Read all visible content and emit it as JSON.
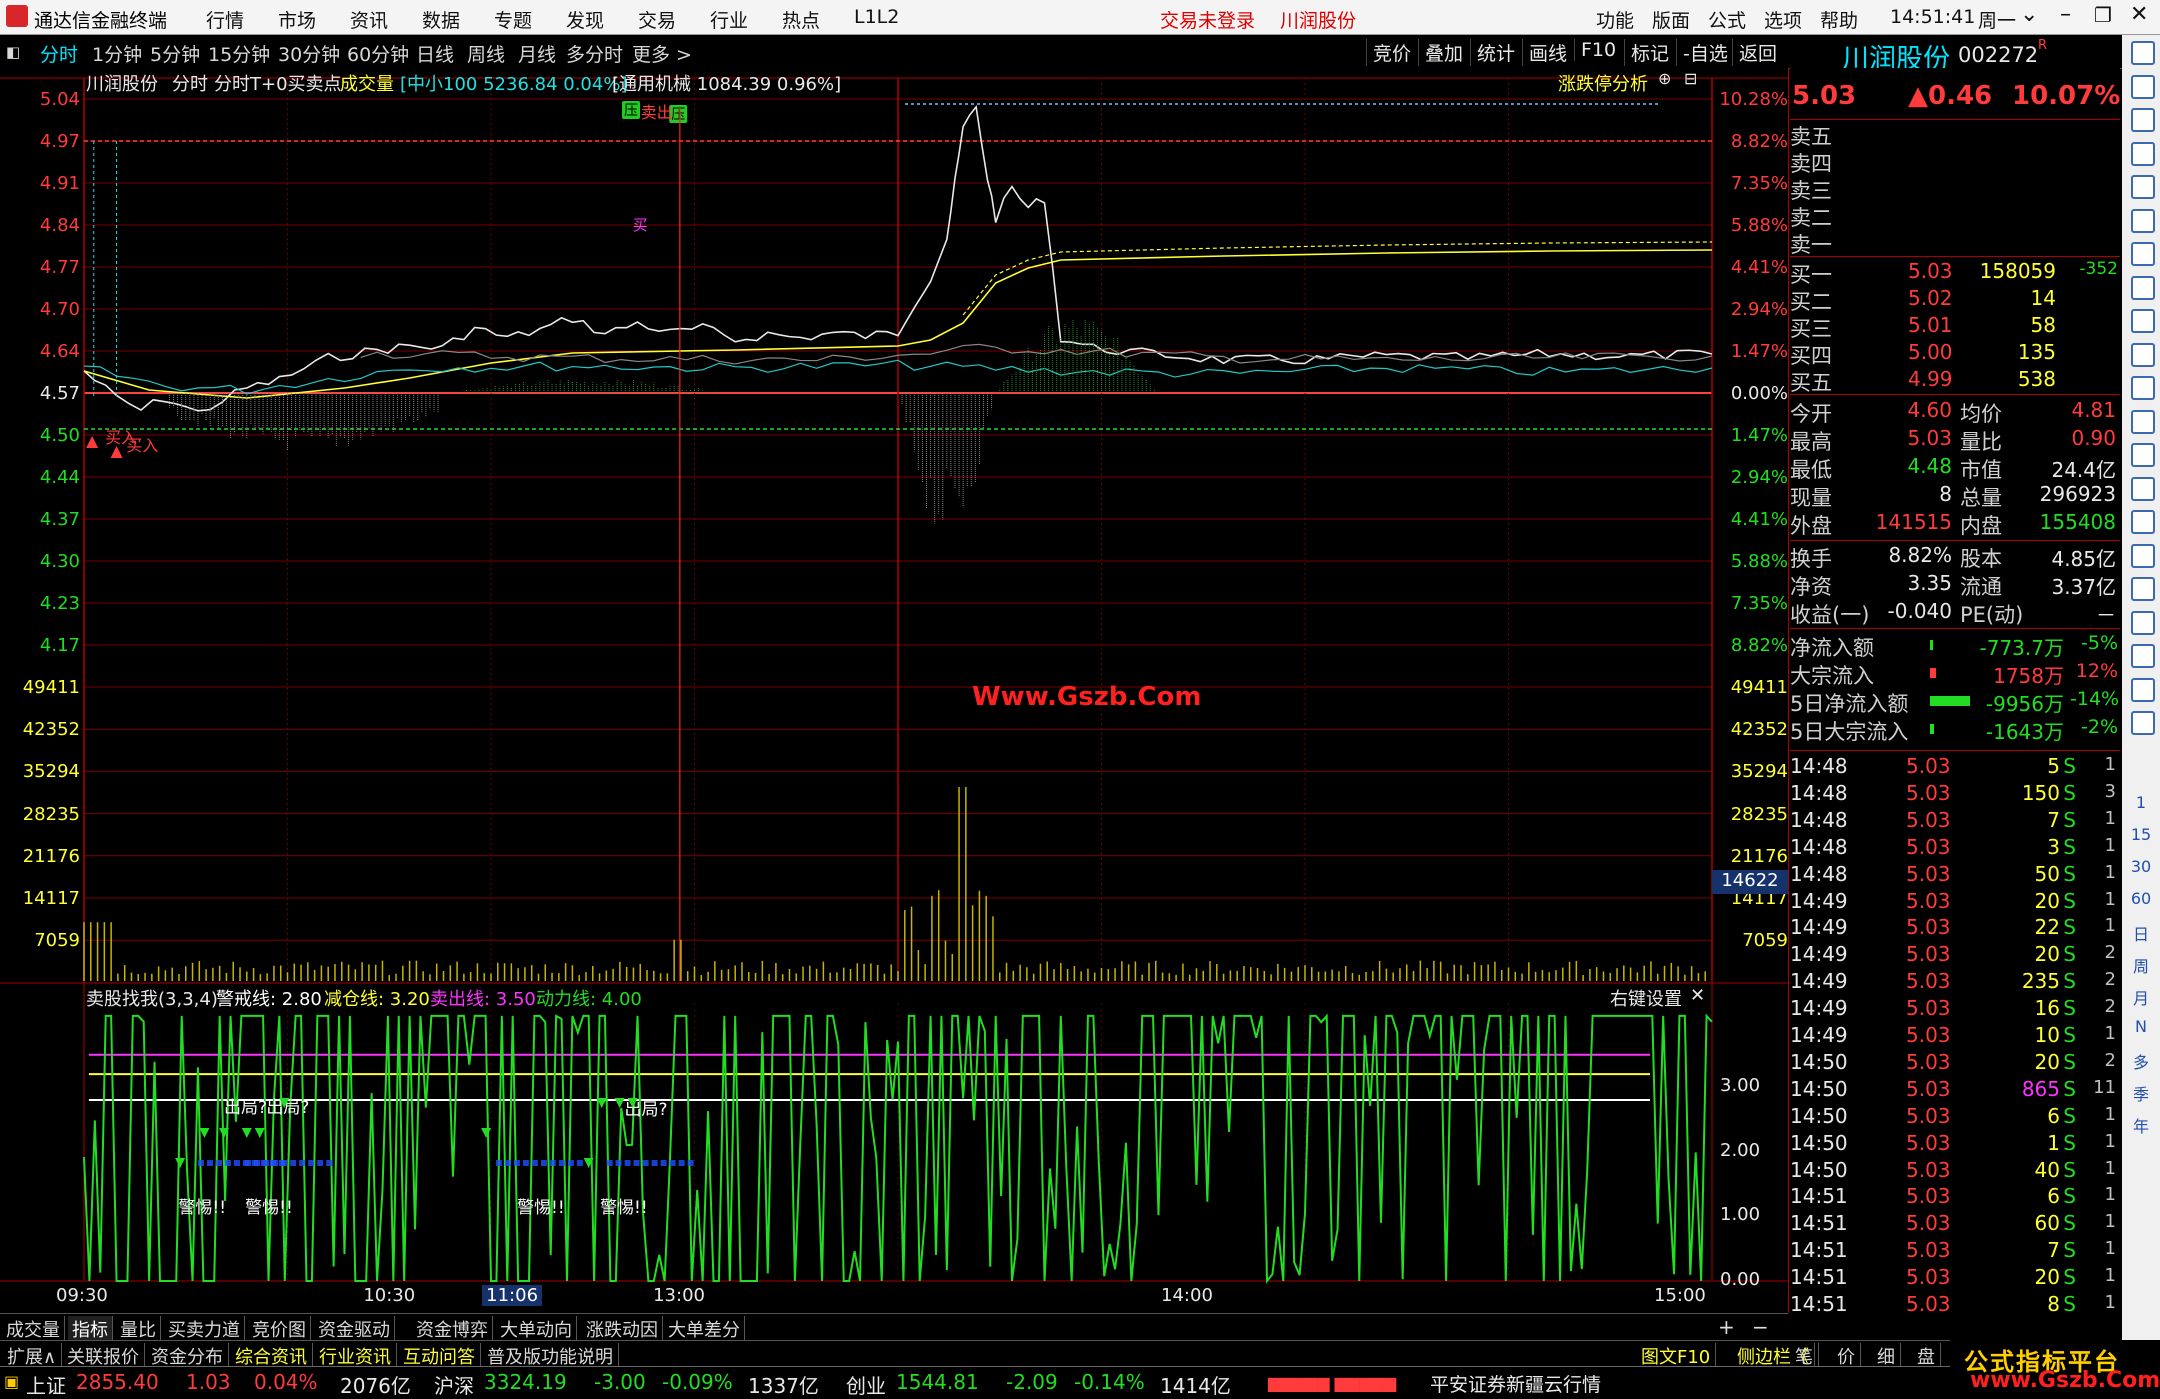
{
  "app": {
    "title": "通达信金融终端",
    "menu": [
      "行情",
      "市场",
      "资讯",
      "数据",
      "专题",
      "发现",
      "交易",
      "行业",
      "热点",
      "L1L2"
    ],
    "login_status": "交易未登录",
    "stock_name_top": "川润股份",
    "right_menu": [
      "功能",
      "版面",
      "公式",
      "选项",
      "帮助"
    ],
    "clock": "14:51:41",
    "weekday": "周一"
  },
  "toolbar": {
    "periods": [
      "分时",
      "1分钟",
      "5分钟",
      "15分钟",
      "30分钟",
      "60分钟",
      "日线",
      "周线",
      "月线",
      "多分时",
      "更多 >"
    ],
    "active_period": "分时",
    "right_buttons": [
      "竞价",
      "叠加",
      "统计",
      "画线",
      "F10",
      "标记",
      "-自选",
      "返回"
    ]
  },
  "chart": {
    "legend": {
      "stock": "川润股份",
      "mode": "分时",
      "indicator": "分时T+0买卖点",
      "volume_label": "成交量",
      "index1": "[中小100 5236.84 0.04%]",
      "index2": "[通用机械 1084.39 0.96%]",
      "analysis_link": "涨跌停分析"
    },
    "price_ticks": [
      "5.04",
      "4.97",
      "4.91",
      "4.84",
      "4.77",
      "4.70",
      "4.64",
      "4.57",
      "4.50",
      "4.44",
      "4.37",
      "4.30",
      "4.23",
      "4.17"
    ],
    "pct_ticks": [
      "10.28%",
      "8.82%",
      "7.35%",
      "5.88%",
      "4.41%",
      "2.94%",
      "1.47%",
      "0.00%",
      "1.47%",
      "2.94%",
      "4.41%",
      "5.88%",
      "7.35%",
      "8.82%"
    ],
    "price_tick_colors": [
      "red",
      "red",
      "red",
      "red",
      "red",
      "red",
      "red",
      "white",
      "green",
      "green",
      "green",
      "green",
      "green",
      "green"
    ],
    "volume_ticks": [
      "49411",
      "42352",
      "35294",
      "28235",
      "21176",
      "14117",
      "7059"
    ],
    "volume_cursor": "14622",
    "time_ticks": [
      "09:30",
      "10:30",
      "11:06",
      "13:00",
      "14:00",
      "15:00"
    ],
    "markers": {
      "buy1": "买入",
      "buy2": "买入",
      "sell": "卖出",
      "pressure": "压",
      "mark_x": "买"
    },
    "watermark": "Www.Gszb.Com"
  },
  "indicator": {
    "name": "卖股找我(3,3,4)",
    "lines": [
      {
        "label": "警戒线: 2.80",
        "color": "#ffffff"
      },
      {
        "label": "减仓线: 3.20",
        "color": "#ffff33"
      },
      {
        "label": "卖出线: 3.50",
        "color": "#ff33ff"
      },
      {
        "label": "动力线: 4.00",
        "color": "#22dd22"
      }
    ],
    "settings": "右键设置",
    "y_ticks": [
      "3.00",
      "2.00",
      "1.00",
      "0.00"
    ],
    "annotations": [
      "出局?",
      "出局?",
      "出局?",
      "警惕!!",
      "警惕!!",
      "警惕!!",
      "警惕!!"
    ]
  },
  "quote": {
    "name": "川润股份",
    "code": "002272",
    "price": "5.03",
    "change": "▲0.46",
    "pct": "10.07%",
    "asks": [
      {
        "label": "卖五",
        "price": "",
        "vol": ""
      },
      {
        "label": "卖四",
        "price": "",
        "vol": ""
      },
      {
        "label": "卖三",
        "price": "",
        "vol": ""
      },
      {
        "label": "卖二",
        "price": "",
        "vol": ""
      },
      {
        "label": "卖一",
        "price": "",
        "vol": ""
      }
    ],
    "bids": [
      {
        "label": "买一",
        "price": "5.03",
        "vol": "158059",
        "chg": "-352"
      },
      {
        "label": "买二",
        "price": "5.02",
        "vol": "14",
        "chg": ""
      },
      {
        "label": "买三",
        "price": "5.01",
        "vol": "58",
        "chg": ""
      },
      {
        "label": "买四",
        "price": "5.00",
        "vol": "135",
        "chg": ""
      },
      {
        "label": "买五",
        "price": "4.99",
        "vol": "538",
        "chg": ""
      }
    ],
    "stats1": [
      {
        "l1": "今开",
        "v1": "4.60",
        "c1": "red",
        "l2": "均价",
        "v2": "4.81",
        "c2": "red"
      },
      {
        "l1": "最高",
        "v1": "5.03",
        "c1": "red",
        "l2": "量比",
        "v2": "0.90",
        "c2": "red"
      },
      {
        "l1": "最低",
        "v1": "4.48",
        "c1": "green",
        "l2": "市值",
        "v2": "24.4亿",
        "c2": "white"
      },
      {
        "l1": "现量",
        "v1": "8",
        "c1": "white",
        "l2": "总量",
        "v2": "296923",
        "c2": "white"
      },
      {
        "l1": "外盘",
        "v1": "141515",
        "c1": "red",
        "l2": "内盘",
        "v2": "155408",
        "c2": "green"
      }
    ],
    "stats2": [
      {
        "l1": "换手",
        "v1": "8.82%",
        "l2": "股本",
        "v2": "4.85亿"
      },
      {
        "l1": "净资",
        "v1": "3.35",
        "l2": "流通",
        "v2": "3.37亿"
      },
      {
        "l1": "收益(一)",
        "v1": "-0.040",
        "l2": "PE(动)",
        "v2": "－"
      }
    ],
    "flows": [
      {
        "label": "净流入额",
        "value": "-773.7万",
        "pct": "-5%",
        "color": "green"
      },
      {
        "label": "大宗流入",
        "value": "1758万",
        "pct": "12%",
        "color": "red"
      },
      {
        "label": "5日净流入额",
        "value": "-9956万",
        "pct": "-14%",
        "color": "green"
      },
      {
        "label": "5日大宗流入",
        "value": "-1643万",
        "pct": "-2%",
        "color": "green"
      }
    ],
    "ticks": [
      {
        "t": "14:48",
        "p": "5.03",
        "v": "5",
        "s": "S",
        "n": "1"
      },
      {
        "t": "14:48",
        "p": "5.03",
        "v": "150",
        "s": "S",
        "n": "3"
      },
      {
        "t": "14:48",
        "p": "5.03",
        "v": "7",
        "s": "S",
        "n": "1"
      },
      {
        "t": "14:48",
        "p": "5.03",
        "v": "3",
        "s": "S",
        "n": "1"
      },
      {
        "t": "14:48",
        "p": "5.03",
        "v": "50",
        "s": "S",
        "n": "1"
      },
      {
        "t": "14:49",
        "p": "5.03",
        "v": "20",
        "s": "S",
        "n": "1"
      },
      {
        "t": "14:49",
        "p": "5.03",
        "v": "22",
        "s": "S",
        "n": "1"
      },
      {
        "t": "14:49",
        "p": "5.03",
        "v": "20",
        "s": "S",
        "n": "2"
      },
      {
        "t": "14:49",
        "p": "5.03",
        "v": "235",
        "s": "S",
        "n": "2"
      },
      {
        "t": "14:49",
        "p": "5.03",
        "v": "16",
        "s": "S",
        "n": "2"
      },
      {
        "t": "14:49",
        "p": "5.03",
        "v": "10",
        "s": "S",
        "n": "1"
      },
      {
        "t": "14:50",
        "p": "5.03",
        "v": "20",
        "s": "S",
        "n": "2"
      },
      {
        "t": "14:50",
        "p": "5.03",
        "v": "865",
        "s": "S",
        "n": "11"
      },
      {
        "t": "14:50",
        "p": "5.03",
        "v": "6",
        "s": "S",
        "n": "1"
      },
      {
        "t": "14:50",
        "p": "5.03",
        "v": "1",
        "s": "S",
        "n": "1"
      },
      {
        "t": "14:50",
        "p": "5.03",
        "v": "40",
        "s": "S",
        "n": "1"
      },
      {
        "t": "14:51",
        "p": "5.03",
        "v": "6",
        "s": "S",
        "n": "1"
      },
      {
        "t": "14:51",
        "p": "5.03",
        "v": "60",
        "s": "S",
        "n": "1"
      },
      {
        "t": "14:51",
        "p": "5.03",
        "v": "7",
        "s": "S",
        "n": "1"
      },
      {
        "t": "14:51",
        "p": "5.03",
        "v": "20",
        "s": "S",
        "n": "1"
      },
      {
        "t": "14:51",
        "p": "5.03",
        "v": "8",
        "s": "S",
        "n": "1"
      }
    ]
  },
  "sidebar_labels": [
    "1",
    "15",
    "30",
    "60",
    "日",
    "周",
    "月",
    "N",
    "多",
    "季",
    "年"
  ],
  "bottom_tabs1": [
    "成交量",
    "指标",
    "量比",
    "买卖力道",
    "竞价图",
    "资金驱动",
    "资金博弈",
    "大单动向",
    "涨跌动因",
    "大单差分"
  ],
  "bottom_tabs1_active": "指标",
  "bottom_tabs2": [
    "扩展∧",
    "关联报价",
    "资金分布",
    "综合资讯",
    "行业资讯",
    "互动问答",
    "普及版功能说明"
  ],
  "bottom_right_tabs": [
    "图文F10",
    "侧边栏《",
    "笔",
    "价",
    "细",
    "盘"
  ],
  "status": {
    "indices": [
      {
        "name": "上证",
        "value": "2855.40",
        "chg": "1.03",
        "pct": "0.04%",
        "amt": "2076亿"
      },
      {
        "name": "沪深",
        "value": "3324.19",
        "chg": "-3.00",
        "pct": "-0.09%",
        "amt": "1337亿"
      },
      {
        "name": "创业",
        "value": "1544.81",
        "chg": "-2.09",
        "pct": "-0.14%",
        "amt": "1414亿"
      }
    ],
    "broker": "平安证券新疆云行情"
  },
  "brand": {
    "title": "公式指标平台",
    "url": "www.Gszb.Com"
  },
  "colors": {
    "up": "#ff3b3b",
    "down": "#22dd22",
    "grid": "#8b0000",
    "accent": "#00e5ff",
    "price": "#e8e8e8",
    "avg": "#ffff33"
  }
}
